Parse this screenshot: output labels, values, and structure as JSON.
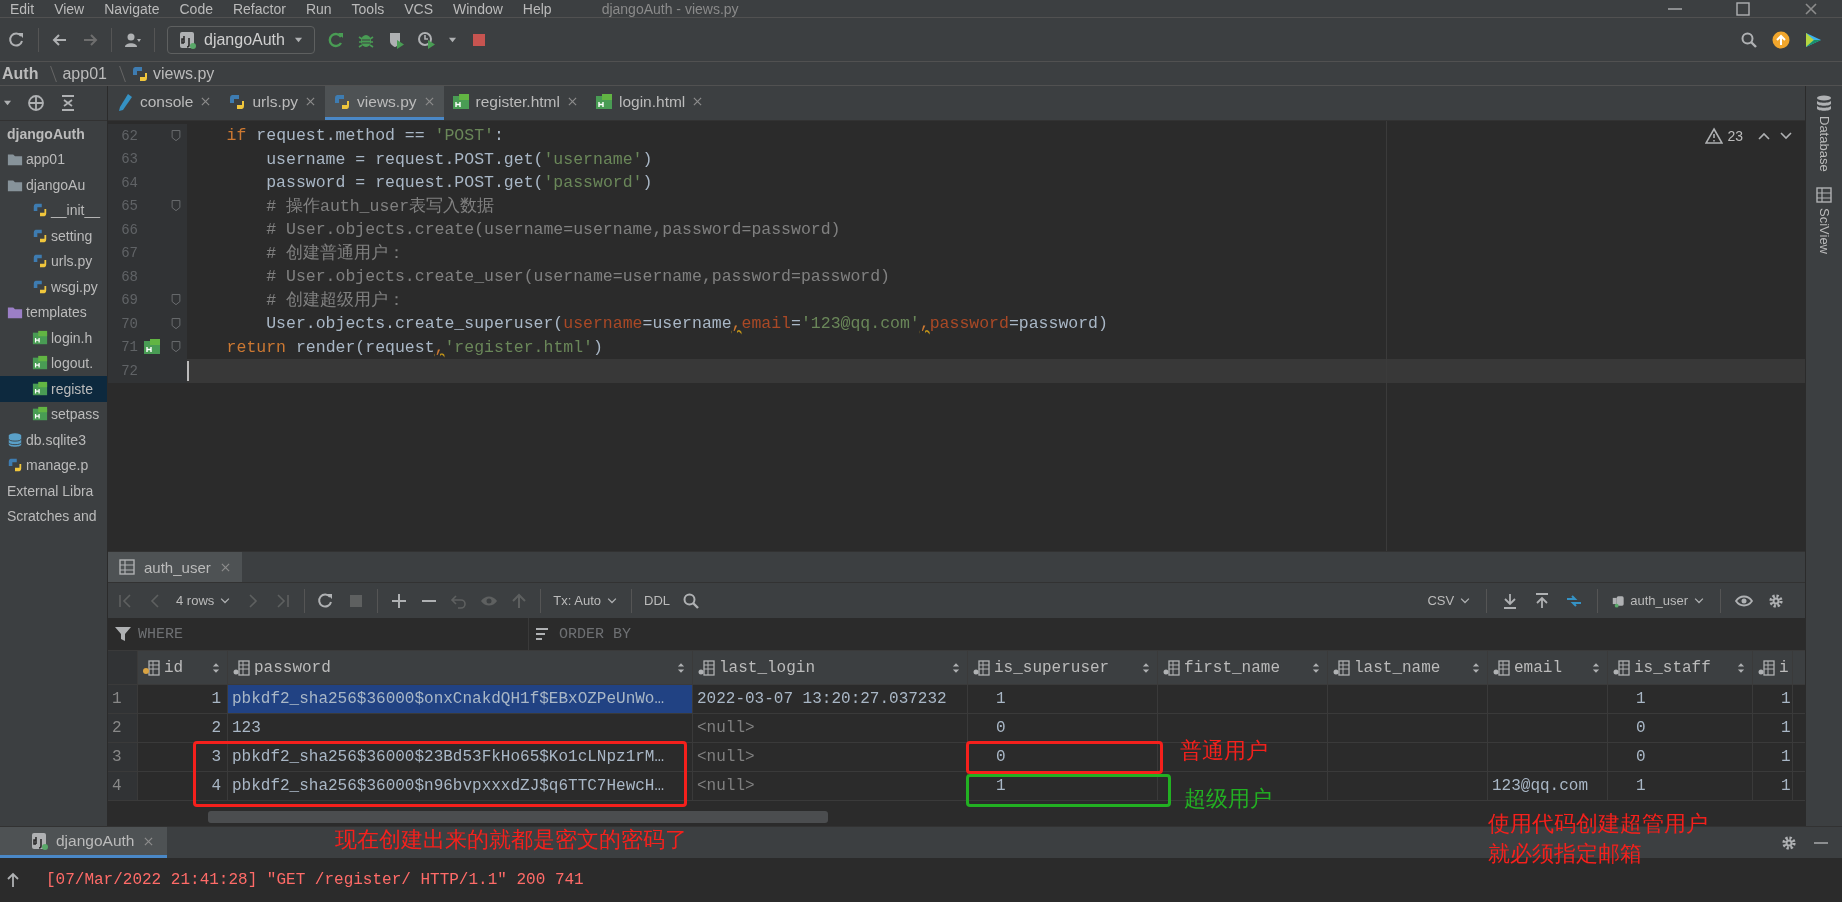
{
  "menu_bar": {
    "items": [
      "Edit",
      "View",
      "Navigate",
      "Code",
      "Refactor",
      "Run",
      "Tools",
      "VCS",
      "Window",
      "Help"
    ],
    "title": "djangoAuth - views.py"
  },
  "toolbar": {
    "run_config": "djangoAuth"
  },
  "breadcrumb": [
    {
      "label": "Auth",
      "kind": "project"
    },
    {
      "label": "app01",
      "kind": "folder"
    },
    {
      "label": "views.py",
      "kind": "python"
    }
  ],
  "editor_tabs": [
    {
      "label": "console",
      "kind": "console",
      "selected": false
    },
    {
      "label": "urls.py",
      "kind": "python",
      "selected": false
    },
    {
      "label": "views.py",
      "kind": "python",
      "selected": true
    },
    {
      "label": "register.html",
      "kind": "html",
      "selected": false
    },
    {
      "label": "login.html",
      "kind": "html",
      "selected": false
    }
  ],
  "project_tree": [
    {
      "label": "djangoAuth",
      "kind": "project",
      "selected": false,
      "children": [
        {
          "label": "app01",
          "kind": "folder",
          "selected": false
        },
        {
          "label": "djangoAu",
          "kind": "folder",
          "selected": false,
          "children": [
            {
              "label": "__init__",
              "kind": "python",
              "selected": false
            },
            {
              "label": "setting",
              "kind": "python",
              "selected": false
            },
            {
              "label": "urls.py",
              "kind": "python",
              "selected": false
            },
            {
              "label": "wsgi.py",
              "kind": "python",
              "selected": false
            }
          ]
        },
        {
          "label": "templates",
          "kind": "template_folder",
          "selected": false,
          "children": [
            {
              "label": "login.h",
              "kind": "html",
              "selected": false
            },
            {
              "label": "logout.",
              "kind": "html",
              "selected": false
            },
            {
              "label": "registe",
              "kind": "html",
              "selected": true
            },
            {
              "label": "setpass",
              "kind": "html",
              "selected": false
            }
          ]
        },
        {
          "label": "db.sqlite3",
          "kind": "database",
          "selected": false
        },
        {
          "label": "manage.p",
          "kind": "python",
          "selected": false
        }
      ]
    },
    {
      "label": "External Libra",
      "kind": "library",
      "selected": false
    },
    {
      "label": "Scratches and",
      "kind": "scratches",
      "selected": false
    }
  ],
  "editor": {
    "warnings": "23",
    "lines": [
      {
        "number": "62",
        "fold": true,
        "current": false,
        "segments": [
          {
            "text": "    if",
            "kind": "kw"
          },
          {
            "text": " request.method == ",
            "kind": "plain"
          },
          {
            "text": "'POST'",
            "kind": "str"
          },
          {
            "text": ":",
            "kind": "plain"
          }
        ]
      },
      {
        "number": "63",
        "fold": false,
        "current": false,
        "segments": [
          {
            "text": "        username = request.POST.get(",
            "kind": "plain"
          },
          {
            "text": "'username'",
            "kind": "str"
          },
          {
            "text": ")",
            "kind": "plain"
          }
        ]
      },
      {
        "number": "64",
        "fold": false,
        "current": false,
        "segments": [
          {
            "text": "        password = request.POST.get(",
            "kind": "plain"
          },
          {
            "text": "'password'",
            "kind": "str"
          },
          {
            "text": ")",
            "kind": "plain"
          }
        ]
      },
      {
        "number": "65",
        "fold": true,
        "current": false,
        "segments": [
          {
            "text": "        # 操作auth_user表写入数据",
            "kind": "comment"
          }
        ]
      },
      {
        "number": "66",
        "fold": false,
        "current": false,
        "segments": [
          {
            "text": "        # User.objects.create(username=username,password=password)",
            "kind": "comment"
          }
        ]
      },
      {
        "number": "67",
        "fold": false,
        "current": false,
        "segments": [
          {
            "text": "        # 创建普通用户：",
            "kind": "comment"
          }
        ]
      },
      {
        "number": "68",
        "fold": false,
        "current": false,
        "segments": [
          {
            "text": "        # User.objects.create_user(username=username,password=password)",
            "kind": "comment"
          }
        ]
      },
      {
        "number": "69",
        "fold": true,
        "current": false,
        "segments": [
          {
            "text": "        # 创建超级用户：",
            "kind": "comment"
          }
        ]
      },
      {
        "number": "70",
        "fold": true,
        "current": false,
        "segments": [
          {
            "text": "        User.objects.create_superuser(",
            "kind": "plain"
          },
          {
            "text": "username",
            "kind": "param"
          },
          {
            "text": "=username",
            "kind": "plain"
          },
          {
            "text": ",",
            "kind": "warn"
          },
          {
            "text": "email",
            "kind": "param"
          },
          {
            "text": "=",
            "kind": "plain"
          },
          {
            "text": "'123@qq.com'",
            "kind": "str"
          },
          {
            "text": ",",
            "kind": "warn"
          },
          {
            "text": "password",
            "kind": "param"
          },
          {
            "text": "=password)",
            "kind": "plain"
          }
        ]
      },
      {
        "number": "71",
        "fold": true,
        "current": false,
        "template_marker": true,
        "segments": [
          {
            "text": "    return",
            "kind": "kw"
          },
          {
            "text": " render(request",
            "kind": "plain"
          },
          {
            "text": ",",
            "kind": "warn"
          },
          {
            "text": "'register.html'",
            "kind": "str"
          },
          {
            "text": ")",
            "kind": "plain"
          }
        ]
      },
      {
        "number": "72",
        "fold": false,
        "current": true
      }
    ]
  },
  "db_panel": {
    "tab": "auth_user",
    "rows_label": "4 rows",
    "tx": "Tx: Auto",
    "ddl": "DDL",
    "format": "CSV",
    "table_selector": "auth_user",
    "where": "WHERE",
    "order_by": "ORDER BY",
    "columns": [
      {
        "label": "id",
        "kind": "key"
      },
      {
        "label": "password",
        "kind": "column"
      },
      {
        "label": "last_login",
        "kind": "column"
      },
      {
        "label": "is_superuser",
        "kind": "column"
      },
      {
        "label": "first_name",
        "kind": "column"
      },
      {
        "label": "last_name",
        "kind": "column"
      },
      {
        "label": "email",
        "kind": "column"
      },
      {
        "label": "is_staff",
        "kind": "column"
      },
      {
        "label": "i",
        "kind": "column"
      }
    ],
    "rows": [
      {
        "number": "1",
        "cells": [
          {
            "text": "1",
            "selected": false
          },
          {
            "text": "pbkdf2_sha256$36000$onxCnakdQH1f$EBxOZPeUnWo…",
            "selected": true
          },
          {
            "text": "2022-03-07 13:20:27.037232",
            "selected": false
          },
          {
            "text": "1",
            "selected": false
          },
          {
            "selected": false
          },
          {
            "selected": false
          },
          {
            "selected": false
          },
          {
            "text": "1",
            "selected": false
          },
          {
            "text": "1",
            "selected": false
          }
        ]
      },
      {
        "number": "2",
        "cells": [
          {
            "text": "2",
            "selected": false
          },
          {
            "text": "123",
            "selected": false
          },
          {
            "text": "<null>",
            "null": true,
            "selected": false
          },
          {
            "text": "0",
            "selected": false
          },
          {
            "selected": false
          },
          {
            "selected": false
          },
          {
            "selected": false
          },
          {
            "text": "0",
            "selected": false
          },
          {
            "text": "1",
            "selected": false
          }
        ]
      },
      {
        "number": "3",
        "cells": [
          {
            "text": "3",
            "selected": false
          },
          {
            "text": "pbkdf2_sha256$36000$23Bd53FkHo65$Ko1cLNpz1rM…",
            "selected": false
          },
          {
            "text": "<null>",
            "null": true,
            "selected": false
          },
          {
            "text": "0",
            "selected": false
          },
          {
            "selected": false
          },
          {
            "selected": false
          },
          {
            "selected": false
          },
          {
            "text": "0",
            "selected": false
          },
          {
            "text": "1",
            "selected": false
          }
        ]
      },
      {
        "number": "4",
        "cells": [
          {
            "text": "4",
            "selected": false
          },
          {
            "text": "pbkdf2_sha256$36000$n96bvpxxxdZJ$q6TTC7HewcH…",
            "selected": false
          },
          {
            "text": "<null>",
            "null": true,
            "selected": false
          },
          {
            "text": "1",
            "selected": false
          },
          {
            "selected": false
          },
          {
            "selected": false
          },
          {
            "text": "123@qq.com",
            "selected": false
          },
          {
            "text": "1",
            "selected": false
          },
          {
            "text": "1",
            "selected": false
          }
        ]
      }
    ]
  },
  "run_panel": {
    "tab": "djangoAuth",
    "log": "[07/Mar/2022 21:41:28] \"GET /register/ HTTP/1.1\" 200 741"
  },
  "side_tools": [
    "Database",
    "SciView"
  ],
  "annotations": [
    {
      "kind": "box",
      "color": "#f5201c"
    },
    {
      "kind": "box",
      "color": "#f5201c"
    },
    {
      "kind": "box",
      "color": "#22b022"
    },
    {
      "kind": "note",
      "color": "#f5201c",
      "text": "普通用户"
    },
    {
      "kind": "note",
      "color": "#22b022",
      "text": "超级用户"
    },
    {
      "kind": "note",
      "color": "#f5201c",
      "text": "现在创建出来的就都是密文的密码了"
    },
    {
      "kind": "note",
      "color": "#f5201c",
      "text": "使用代码创建超管用户"
    },
    {
      "kind": "note",
      "color": "#f5201c",
      "text": "就必须指定邮箱"
    }
  ]
}
